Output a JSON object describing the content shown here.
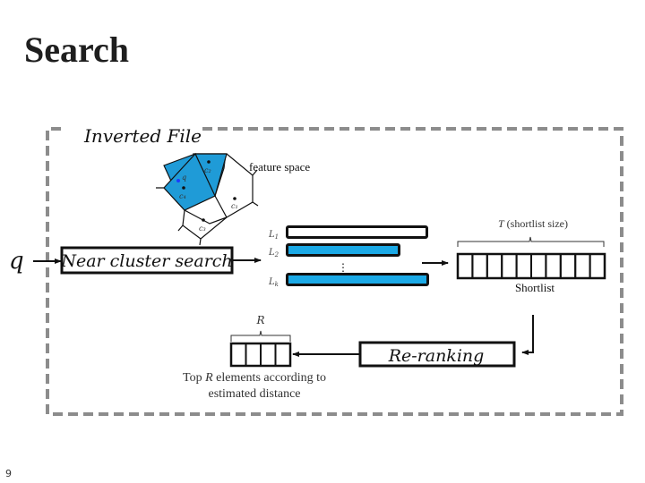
{
  "slide": {
    "title": "Search",
    "page_number": "9"
  },
  "diagram": {
    "frame_label": "Inverted File",
    "feature_space_label": "feature space",
    "query_label": "q",
    "near_cluster_search_label": "Near cluster search",
    "voronoi": {
      "highlight_color": "#1f9bd7",
      "cells": [
        {
          "label": "c₂",
          "highlighted": true
        },
        {
          "label": "c₄",
          "highlighted": true,
          "contains_query": true
        },
        {
          "label": "c₁",
          "highlighted": false
        },
        {
          "label": "c₃",
          "highlighted": false
        }
      ],
      "query_point_label": "q",
      "query_point_color": "#1a3cff"
    },
    "inverted_lists": {
      "fill_color": "#1ba9e6",
      "items": [
        {
          "label": "L",
          "sub": "1",
          "selected": false
        },
        {
          "label": "L",
          "sub": "2",
          "selected": true
        },
        {
          "label": "L",
          "sub": "k",
          "selected": true
        }
      ],
      "ellipsis": "⋮"
    },
    "shortlist": {
      "size_label": "T (shortlist size)",
      "size_var": "T",
      "size_text": " (shortlist size)",
      "cell_count": 10,
      "label": "Shortlist"
    },
    "reranking_label": "Re-ranking",
    "top_r": {
      "var": "R",
      "cell_count": 4,
      "caption_line1_pre": "Top ",
      "caption_line1_var": "R",
      "caption_line1_post": " elements according to",
      "caption_line2": "estimated distance"
    },
    "colors": {
      "frame_dash": "#8c8c8c",
      "stroke": "#111111"
    }
  }
}
